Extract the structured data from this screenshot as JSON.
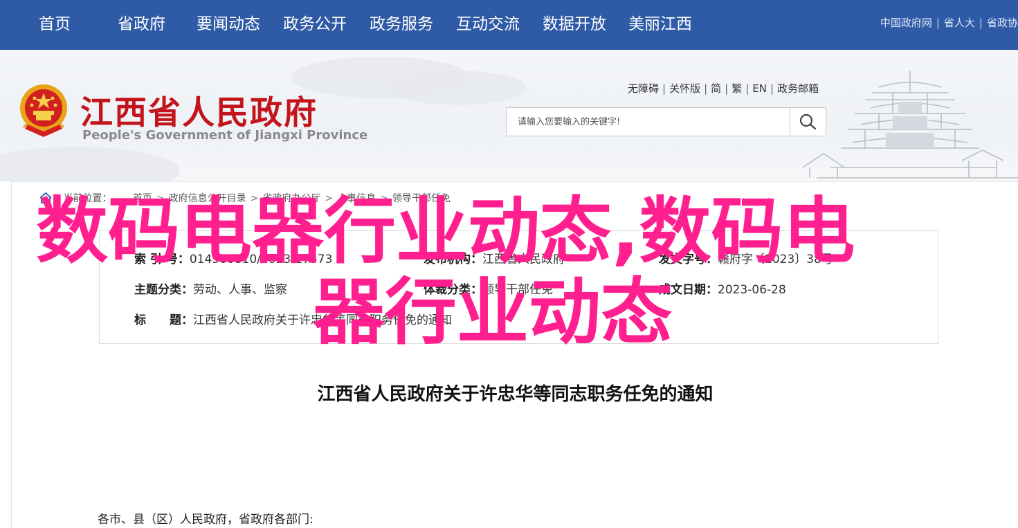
{
  "top_nav": {
    "items": [
      "首页",
      "省政府",
      "要闻动态",
      "政务公开",
      "政务服务",
      "互动交流",
      "数据开放",
      "美丽江西"
    ],
    "links": [
      "中国政府网",
      "省人大",
      "省政协"
    ],
    "colors": {
      "background": "#2e5aa6",
      "text": "#ffffff"
    }
  },
  "header": {
    "site_title": "江西省人民政府",
    "site_subtitle": "People's Government of Jiangxi Province",
    "toolbar": [
      "无障碍",
      "关怀版",
      "简",
      "繁",
      "EN",
      "政务邮箱"
    ],
    "search": {
      "placeholder": "请输入您要输入的关键字!",
      "button_icon": "search-icon"
    },
    "colors": {
      "title": "#c3141b"
    }
  },
  "breadcrumb": {
    "label": "当前位置：",
    "items": [
      "首页",
      "政府信息公开目录",
      "省政府办公厅",
      "人事信息",
      "领导干部任免"
    ]
  },
  "meta": {
    "index_label": "索 引 号：",
    "index_value": "014500810/2023-17573",
    "publisher_label": "发布机构：",
    "publisher_value": "江西省人民政府",
    "topic_label": "主题分类：",
    "topic_value": "劳动、人事、监察",
    "doc_no_label": "发文字号：",
    "doc_no_value": "赣府字〔2023〕38号",
    "genre_label": "体裁分类：",
    "genre_value": "领导干部任免",
    "date_label": "成文日期：",
    "date_value": "2023-06-28",
    "title_label": "标　　题：",
    "title_value": "江西省人民政府关于许忠华等同志职务任免的通知"
  },
  "document": {
    "title": "江西省人民政府关于许忠华等同志职务任免的通知",
    "salutation": "各市、县（区）人民政府，省政府各部门:"
  },
  "overlay": {
    "line1": "数码电器行业动态,数码电",
    "line2": "器行业动态",
    "color": "#ff1f8e"
  }
}
